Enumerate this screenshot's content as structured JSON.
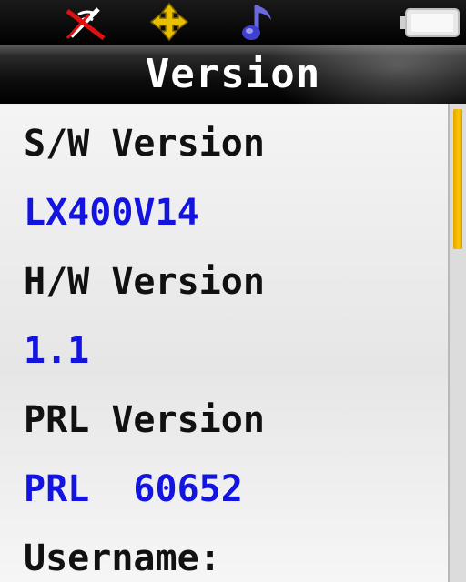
{
  "status_bar": {
    "icons": [
      "no-signal-icon",
      "roaming-icon",
      "music-note-icon",
      "battery-icon"
    ]
  },
  "title": "Version",
  "items": [
    {
      "label": "S/W Version",
      "value": "LX400V14"
    },
    {
      "label": "H/W Version",
      "value": "1.1"
    },
    {
      "label": "PRL Version",
      "value": "PRL  60652"
    },
    {
      "label": "Username:"
    }
  ],
  "scrollbar": {
    "position_fraction": 0.0,
    "visible_fraction": 0.3
  },
  "colors": {
    "label": "#111111",
    "value": "#1414e0",
    "scroll_thumb": "#ffc800",
    "title_bar": "#000000"
  }
}
